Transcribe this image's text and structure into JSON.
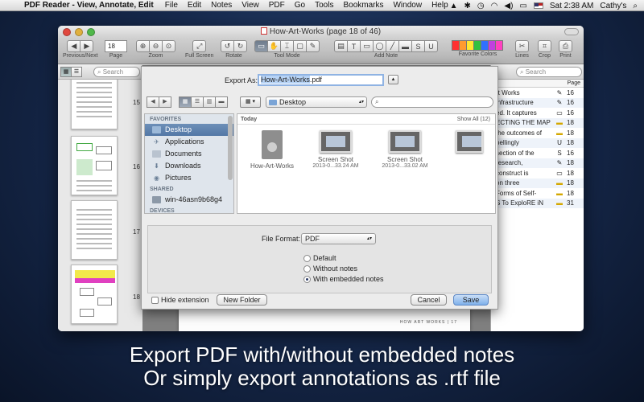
{
  "menubar": {
    "app_name": "PDF Reader - View, Annotate, Edit",
    "items": [
      "File",
      "Edit",
      "Notes",
      "View",
      "PDF",
      "Go",
      "Tools",
      "Bookmarks",
      "Window",
      "Help"
    ],
    "clock": "Sat 2:38 AM",
    "user": "Cathy's"
  },
  "window": {
    "title": "How-Art-Works (page 18 of 46)"
  },
  "toolbar": {
    "page_number": "18",
    "labels": {
      "previous_next": "Previous/Next",
      "page": "Page",
      "zoom": "Zoom",
      "full_screen": "Full Screen",
      "rotate": "Rotate",
      "tool_mode": "Tool Mode",
      "add_note": "Add Note",
      "favorite_colors": "Favorite Colors",
      "lines": "Lines",
      "crop": "Crop",
      "print": "Print"
    },
    "colors": [
      "#ff3030",
      "#ff9a30",
      "#ffe730",
      "#30c040",
      "#3070ff",
      "#c040e0",
      "#ff40c0"
    ]
  },
  "sidebar": {
    "search_placeholder": "Search",
    "pages": [
      "15",
      "16",
      "17",
      "18"
    ]
  },
  "main": {
    "footer": "HOW ART WORKS | 17"
  },
  "notes_panel": {
    "search_placeholder": "Search",
    "page_header": "Page",
    "rows": [
      {
        "text": "rt Works",
        "icon": "✎",
        "page": "16"
      },
      {
        "text": "infrastructure",
        "icon": "✎",
        "page": "16"
      },
      {
        "text": "ed. It captures",
        "icon": "▭",
        "page": "16"
      },
      {
        "text": "ECTING THE MAP",
        "icon": "▬",
        "page": "18"
      },
      {
        "text": "the outcomes of",
        "icon": "▬",
        "page": "18"
      },
      {
        "text": "pellingly",
        "icon": "U",
        "page": "18"
      },
      {
        "text": "section of the",
        "icon": "S",
        "page": "16"
      },
      {
        "text": "research,",
        "icon": "✎",
        "page": "18"
      },
      {
        "text": "construct is",
        "icon": "▭",
        "page": "18"
      },
      {
        "text": "on three",
        "icon": "▬",
        "page": "18"
      },
      {
        "text": "Forms of Self-",
        "icon": "▬",
        "page": "18"
      },
      {
        "text": "S To ExploRE iN",
        "icon": "▬",
        "page": "31"
      }
    ]
  },
  "dialog": {
    "export_label": "Export As:",
    "filename_base": "How-Art-Works",
    "filename_ext": ".pdf",
    "location": "Desktop",
    "favorites_header": "FAVORITES",
    "favorites": [
      "Desktop",
      "Applications",
      "Documents",
      "Downloads",
      "Pictures"
    ],
    "shared_header": "SHARED",
    "shared": [
      "win-46asn9b68g4"
    ],
    "devices_header": "DEVICES",
    "files_header": "Today",
    "show_all": "Show All (12)",
    "files": [
      {
        "name": "How-Art-Works",
        "sub": ""
      },
      {
        "name": "Screen Shot",
        "sub": "2013-0...33.24 AM"
      },
      {
        "name": "Screen Shot",
        "sub": "2013-0...33.02 AM"
      }
    ],
    "file_format_label": "File Format:",
    "file_format_value": "PDF",
    "options": [
      "Default",
      "Without notes",
      "With embedded notes"
    ],
    "selected_option": 2,
    "hide_extension": "Hide extension",
    "new_folder": "New Folder",
    "cancel": "Cancel",
    "save": "Save"
  },
  "caption": {
    "line1": "Export PDF with/without embedded notes",
    "line2": "Or simply export annotations as .rtf file"
  }
}
